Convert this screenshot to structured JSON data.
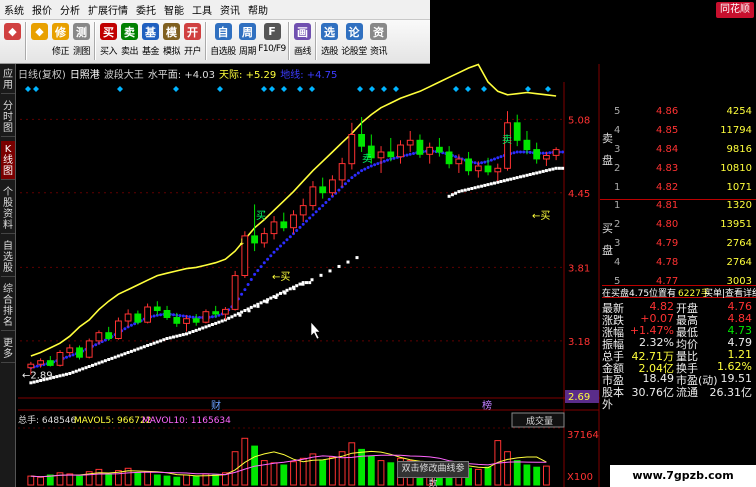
{
  "menu": [
    "系统",
    "报价",
    "分析",
    "扩展行情",
    "委托",
    "智能",
    "工具",
    "资讯",
    "帮助"
  ],
  "brand": "同花顺",
  "toolbar": [
    {
      "label": "",
      "icon": "app-icon",
      "color": "#d04040"
    },
    {
      "label": "",
      "icon": "back-icon",
      "color": "#e8a000"
    },
    {
      "label": "修正",
      "icon": "up-down-icon",
      "color": "#e8a000"
    },
    {
      "label": "测图",
      "icon": "drawing-icon",
      "color": "#888"
    },
    {
      "label": "买入",
      "icon": "buy-icon",
      "color": "#c00000"
    },
    {
      "label": "卖出",
      "icon": "sell-icon",
      "color": "#008000"
    },
    {
      "label": "基金",
      "icon": "fund-icon",
      "color": "#2060c0"
    },
    {
      "label": "模拟",
      "icon": "simulate-icon",
      "color": "#806020"
    },
    {
      "label": "开户",
      "icon": "open-account-icon",
      "color": "#d04040"
    },
    {
      "label": "自选股",
      "icon": "watchlist-icon",
      "color": "#3070c0"
    },
    {
      "label": "周期",
      "icon": "period-icon",
      "color": "#3070c0"
    },
    {
      "label": "F10/F9",
      "icon": "f10-icon",
      "color": "#555"
    },
    {
      "label": "画线",
      "icon": "draw-line-icon",
      "color": "#7050b0"
    },
    {
      "label": "选股",
      "icon": "stock-picker-icon",
      "color": "#3070c0"
    },
    {
      "label": "论股堂",
      "icon": "forum-icon",
      "color": "#3070c0"
    },
    {
      "label": "资讯",
      "icon": "news-icon",
      "color": "#888"
    }
  ],
  "sidetabs": [
    "应用",
    "分时图",
    "K线图",
    "个股资料",
    "自选股",
    "综合排名",
    "更多"
  ],
  "info": {
    "period": "日线(复权)",
    "stock": "日照港",
    "indicator": "波段大王",
    "level": "水平面: +4.03",
    "sky": "天际: +5.29",
    "ground": "地线: +4.75"
  },
  "price_axis": [
    "5.08",
    "4.45",
    "3.81",
    "3.18",
    "2.69"
  ],
  "low_marker": "←2.89",
  "markers": {
    "cai": "财",
    "bang": "榜"
  },
  "signals": {
    "buy1": "买",
    "sell1": "卖",
    "sell2": "卖",
    "buy2": "←买",
    "buy3": "←买",
    "buy4": "←买"
  },
  "volume": {
    "total": "总手: 648546",
    "mavol5": "MAVOL5: 966722",
    "mavol10": "MAVOL10: 1165634",
    "tab": "成交量",
    "v1": "37164",
    "v2": "X100"
  },
  "orderbook": {
    "sell": [
      {
        "level": "5",
        "price": "4.86",
        "vol": "4254"
      },
      {
        "level": "4",
        "price": "4.85",
        "vol": "11794"
      },
      {
        "level": "3",
        "price": "4.84",
        "vol": "9816"
      },
      {
        "level": "2",
        "price": "4.83",
        "vol": "10810"
      },
      {
        "level": "1",
        "price": "4.82",
        "vol": "1071"
      }
    ],
    "buy": [
      {
        "level": "1",
        "price": "4.81",
        "vol": "1320"
      },
      {
        "level": "2",
        "price": "4.80",
        "vol": "13951"
      },
      {
        "level": "3",
        "price": "4.79",
        "vol": "2764"
      },
      {
        "level": "4",
        "price": "4.78",
        "vol": "2764"
      },
      {
        "level": "5",
        "price": "4.77",
        "vol": "3003"
      }
    ],
    "sell_label": "卖盘",
    "buy_label": "买盘",
    "position": "在买盘4.75位置有",
    "pos_vol": "6227手",
    "detail": "买单|查看详细"
  },
  "stats": [
    {
      "l1": "最新",
      "v1": "4.82",
      "l2": "开盘",
      "v2": "4.76"
    },
    {
      "l1": "涨跌",
      "v1": "+0.07",
      "l2": "最高",
      "v2": "4.84"
    },
    {
      "l1": "涨幅",
      "v1": "+1.47%",
      "l2": "最低",
      "v2": "4.73"
    },
    {
      "l1": "振幅",
      "v1": "2.32%",
      "l2": "均价",
      "v2": "4.79"
    },
    {
      "l1": "总手",
      "v1": "42.71万",
      "l2": "量比",
      "v2": "1.21"
    },
    {
      "l1": "金额",
      "v1": "2.04亿",
      "l2": "换手",
      "v2": "1.62%"
    },
    {
      "l1": "市盈",
      "v1": "18.49",
      "l2": "市盈(动)",
      "v2": "19.51"
    },
    {
      "l1": "股本",
      "v1": "30.76亿",
      "l2": "流通",
      "v2": "26.31亿"
    },
    {
      "l1": "外",
      "v1": "",
      "l2": "",
      "v2": ""
    }
  ],
  "tooltip": "双击修改曲线参数",
  "watermark": "www.7gpzb.com",
  "colors": {
    "up": "#ff3232",
    "down": "#00e600",
    "upper_line": "#ffff3c",
    "mid_line": "#2c2cff",
    "support": "#ffffff"
  },
  "chart_data": {
    "type": "line",
    "candles": [
      {
        "o": 2.95,
        "h": 3.0,
        "l": 2.89,
        "c": 2.98
      },
      {
        "o": 2.98,
        "h": 3.03,
        "l": 2.95,
        "c": 3.01
      },
      {
        "o": 3.01,
        "h": 3.05,
        "l": 2.96,
        "c": 2.97
      },
      {
        "o": 2.97,
        "h": 3.1,
        "l": 2.96,
        "c": 3.08
      },
      {
        "o": 3.08,
        "h": 3.15,
        "l": 3.05,
        "c": 3.12
      },
      {
        "o": 3.12,
        "h": 3.14,
        "l": 3.02,
        "c": 3.04
      },
      {
        "o": 3.04,
        "h": 3.2,
        "l": 3.03,
        "c": 3.18
      },
      {
        "o": 3.18,
        "h": 3.27,
        "l": 3.15,
        "c": 3.25
      },
      {
        "o": 3.25,
        "h": 3.3,
        "l": 3.18,
        "c": 3.2
      },
      {
        "o": 3.2,
        "h": 3.38,
        "l": 3.19,
        "c": 3.35
      },
      {
        "o": 3.35,
        "h": 3.45,
        "l": 3.3,
        "c": 3.41
      },
      {
        "o": 3.41,
        "h": 3.44,
        "l": 3.32,
        "c": 3.34
      },
      {
        "o": 3.34,
        "h": 3.5,
        "l": 3.33,
        "c": 3.47
      },
      {
        "o": 3.47,
        "h": 3.52,
        "l": 3.4,
        "c": 3.44
      },
      {
        "o": 3.44,
        "h": 3.48,
        "l": 3.36,
        "c": 3.38
      },
      {
        "o": 3.38,
        "h": 3.42,
        "l": 3.3,
        "c": 3.33
      },
      {
        "o": 3.33,
        "h": 3.4,
        "l": 3.26,
        "c": 3.37
      },
      {
        "o": 3.37,
        "h": 3.41,
        "l": 3.31,
        "c": 3.34
      },
      {
        "o": 3.34,
        "h": 3.45,
        "l": 3.33,
        "c": 3.43
      },
      {
        "o": 3.43,
        "h": 3.48,
        "l": 3.38,
        "c": 3.41
      },
      {
        "o": 3.41,
        "h": 3.47,
        "l": 3.36,
        "c": 3.45
      },
      {
        "o": 3.45,
        "h": 3.78,
        "l": 3.44,
        "c": 3.74
      },
      {
        "o": 3.74,
        "h": 4.12,
        "l": 3.72,
        "c": 4.08
      },
      {
        "o": 4.08,
        "h": 4.35,
        "l": 3.95,
        "c": 4.02
      },
      {
        "o": 4.02,
        "h": 4.15,
        "l": 3.98,
        "c": 4.1
      },
      {
        "o": 4.1,
        "h": 4.25,
        "l": 4.05,
        "c": 4.2
      },
      {
        "o": 4.2,
        "h": 4.28,
        "l": 4.12,
        "c": 4.15
      },
      {
        "o": 4.15,
        "h": 4.3,
        "l": 4.1,
        "c": 4.26
      },
      {
        "o": 4.26,
        "h": 4.4,
        "l": 4.2,
        "c": 4.34
      },
      {
        "o": 4.34,
        "h": 4.55,
        "l": 4.3,
        "c": 4.5
      },
      {
        "o": 4.5,
        "h": 4.58,
        "l": 4.4,
        "c": 4.45
      },
      {
        "o": 4.45,
        "h": 4.6,
        "l": 4.42,
        "c": 4.56
      },
      {
        "o": 4.56,
        "h": 4.75,
        "l": 4.5,
        "c": 4.7
      },
      {
        "o": 4.7,
        "h": 5.05,
        "l": 4.65,
        "c": 4.95
      },
      {
        "o": 4.95,
        "h": 5.1,
        "l": 4.8,
        "c": 4.85
      },
      {
        "o": 4.85,
        "h": 4.95,
        "l": 4.7,
        "c": 4.75
      },
      {
        "o": 4.75,
        "h": 4.85,
        "l": 4.62,
        "c": 4.8
      },
      {
        "o": 4.8,
        "h": 4.92,
        "l": 4.72,
        "c": 4.76
      },
      {
        "o": 4.76,
        "h": 4.9,
        "l": 4.7,
        "c": 4.86
      },
      {
        "o": 4.86,
        "h": 4.98,
        "l": 4.8,
        "c": 4.9
      },
      {
        "o": 4.9,
        "h": 4.95,
        "l": 4.75,
        "c": 4.78
      },
      {
        "o": 4.78,
        "h": 4.88,
        "l": 4.7,
        "c": 4.84
      },
      {
        "o": 4.84,
        "h": 4.92,
        "l": 4.76,
        "c": 4.8
      },
      {
        "o": 4.8,
        "h": 4.85,
        "l": 4.66,
        "c": 4.7
      },
      {
        "o": 4.7,
        "h": 4.78,
        "l": 4.62,
        "c": 4.74
      },
      {
        "o": 4.74,
        "h": 4.8,
        "l": 4.6,
        "c": 4.64
      },
      {
        "o": 4.64,
        "h": 4.72,
        "l": 4.58,
        "c": 4.68
      },
      {
        "o": 4.68,
        "h": 4.75,
        "l": 4.6,
        "c": 4.63
      },
      {
        "o": 4.63,
        "h": 4.7,
        "l": 4.55,
        "c": 4.66
      },
      {
        "o": 4.66,
        "h": 5.15,
        "l": 4.64,
        "c": 5.05
      },
      {
        "o": 5.05,
        "h": 5.12,
        "l": 4.85,
        "c": 4.9
      },
      {
        "o": 4.9,
        "h": 4.98,
        "l": 4.78,
        "c": 4.82
      },
      {
        "o": 4.82,
        "h": 4.88,
        "l": 4.7,
        "c": 4.74
      },
      {
        "o": 4.74,
        "h": 4.8,
        "l": 4.68,
        "c": 4.77
      },
      {
        "o": 4.77,
        "h": 4.84,
        "l": 4.73,
        "c": 4.82
      }
    ],
    "upper": [
      3.05,
      3.08,
      3.12,
      3.16,
      3.22,
      3.3,
      3.36,
      3.45,
      3.52,
      3.58,
      3.62,
      3.66,
      3.7,
      3.74,
      3.76,
      3.78,
      3.8,
      3.81,
      3.83,
      3.85,
      3.88,
      3.95,
      4.05,
      4.15,
      4.22,
      4.3,
      4.38,
      4.46,
      4.55,
      4.64,
      4.72,
      4.8,
      4.88,
      4.96,
      5.05,
      5.12,
      5.18,
      5.22,
      5.26,
      5.29,
      5.32,
      5.36,
      5.4,
      5.44,
      5.48,
      5.52,
      5.55,
      5.4,
      5.32,
      5.29,
      5.3,
      5.31,
      5.3,
      5.29,
      5.28
    ],
    "mid": [
      2.95,
      2.97,
      2.99,
      3.02,
      3.05,
      3.08,
      3.12,
      3.16,
      3.2,
      3.25,
      3.3,
      3.34,
      3.38,
      3.4,
      3.41,
      3.4,
      3.39,
      3.38,
      3.38,
      3.39,
      3.42,
      3.5,
      3.62,
      3.75,
      3.85,
      3.94,
      4.02,
      4.1,
      4.18,
      4.26,
      4.34,
      4.42,
      4.5,
      4.58,
      4.64,
      4.68,
      4.71,
      4.74,
      4.76,
      4.78,
      4.8,
      4.81,
      4.8,
      4.78,
      4.75,
      4.72,
      4.7,
      4.72,
      4.75,
      4.78,
      4.8,
      4.8,
      4.79,
      4.79,
      4.8
    ],
    "support": [
      2.82,
      2.84,
      2.86,
      2.88,
      2.9,
      2.93,
      2.96,
      2.99,
      3.02,
      3.05,
      3.08,
      3.11,
      3.14,
      3.17,
      3.2,
      3.22,
      3.24,
      3.27,
      3.3,
      3.33,
      3.36,
      3.4,
      3.44,
      3.48,
      3.52,
      3.56,
      3.6,
      3.64,
      3.68,
      null,
      null,
      null,
      null,
      null,
      null,
      null,
      null,
      null,
      null,
      null,
      null,
      null,
      null,
      4.42,
      4.46,
      4.48,
      4.5,
      4.52,
      4.54,
      4.56,
      4.58,
      4.6,
      4.62,
      4.64,
      4.66
    ],
    "volume": [
      8,
      7,
      9,
      11,
      10,
      8,
      12,
      14,
      10,
      13,
      15,
      11,
      12,
      9,
      8,
      7,
      9,
      8,
      10,
      9,
      11,
      30,
      42,
      35,
      22,
      20,
      18,
      21,
      24,
      28,
      22,
      25,
      30,
      38,
      32,
      26,
      22,
      20,
      24,
      22,
      19,
      20,
      18,
      16,
      17,
      15,
      14,
      16,
      40,
      30,
      22,
      18,
      16,
      17
    ],
    "ylim": [
      2.69,
      5.4
    ]
  }
}
